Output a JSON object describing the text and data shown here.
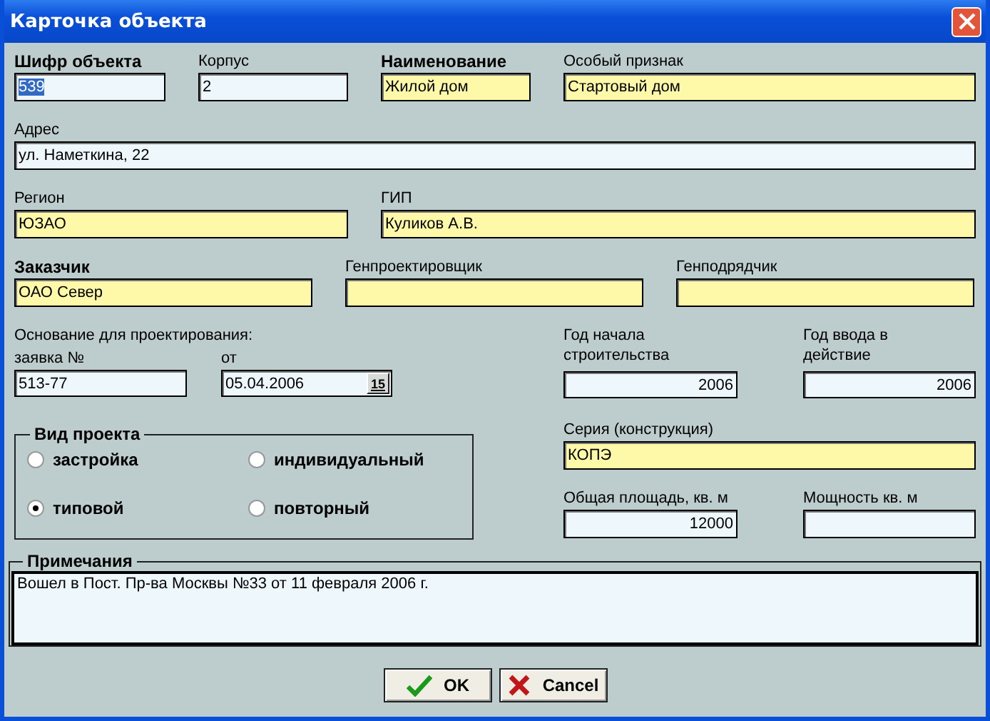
{
  "window": {
    "title": "Карточка объекта"
  },
  "row1": [
    {
      "label": "Шифр объекта",
      "required": true,
      "value": "539",
      "color": "#eef8fc",
      "value_selected": true
    },
    {
      "label": "Корпус",
      "required": false,
      "value": "2",
      "color": "#eef8fc",
      "value_selected": false
    },
    {
      "label": "Наименование",
      "required": true,
      "value": "Жилой дом",
      "color": "#fdf9a8",
      "value_selected": false
    },
    {
      "label": "Особый признак",
      "required": false,
      "value": "Стартовый дом",
      "color": "#fdf9a8",
      "value_selected": false
    }
  ],
  "address": {
    "label": "Адрес",
    "required": false,
    "value": "ул. Наметкина, 22",
    "color": "#eef8fc"
  },
  "row3": [
    {
      "label": "Регион",
      "required": false,
      "value": "ЮЗАО",
      "color": "#fdf9a8"
    },
    {
      "label": "ГИП",
      "required": false,
      "value": "Куликов А.В.",
      "color": "#fdf9a8"
    }
  ],
  "row4": [
    {
      "label": "Заказчик",
      "required": true,
      "value": "ОАО Север",
      "color": "#fdf9a8"
    },
    {
      "label": "Генпроектировщик",
      "required": false,
      "color": "#fdf9a8"
    },
    {
      "label": "Генподрядчик",
      "required": false,
      "color": "#fdf9a8"
    }
  ],
  "basis": {
    "label": "Основание для проектирования:",
    "request": {
      "label": "заявка №",
      "value": "513-77",
      "color": "#eef8fc"
    },
    "date": {
      "label": "от",
      "value": "05.04.2006",
      "color": "#eef8fc",
      "button": "15"
    }
  },
  "start_year": {
    "label": "Год начала строительства",
    "value": "2006",
    "color": "#eef8fc"
  },
  "commission_year": {
    "label": "Год ввода в действие",
    "value": "2006",
    "color": "#eef8fc"
  },
  "project_type": {
    "title": "Вид проекта",
    "options": [
      {
        "label": "застройка",
        "selected": false
      },
      {
        "label": "индивидуальный",
        "selected": false
      },
      {
        "label": "типовой",
        "selected": true
      },
      {
        "label": "повторный",
        "selected": false
      }
    ]
  },
  "series": {
    "label": "Серия (конструкция)",
    "value": "КОПЭ",
    "color": "#fdf9a8"
  },
  "area": {
    "label": "Общая площадь, кв. м",
    "value": "12000",
    "color": "#eef8fc"
  },
  "capacity": {
    "label": "Мощность  кв. м",
    "color": "#eef8fc"
  },
  "notes": {
    "title": "Примечания",
    "text": "Вошел в Пост. Пр-ва Москвы №33 от 11 февраля 2006 г."
  },
  "buttons": [
    {
      "label": "OK",
      "kind": "ok"
    },
    {
      "label": "Cancel",
      "kind": "cancel"
    }
  ]
}
